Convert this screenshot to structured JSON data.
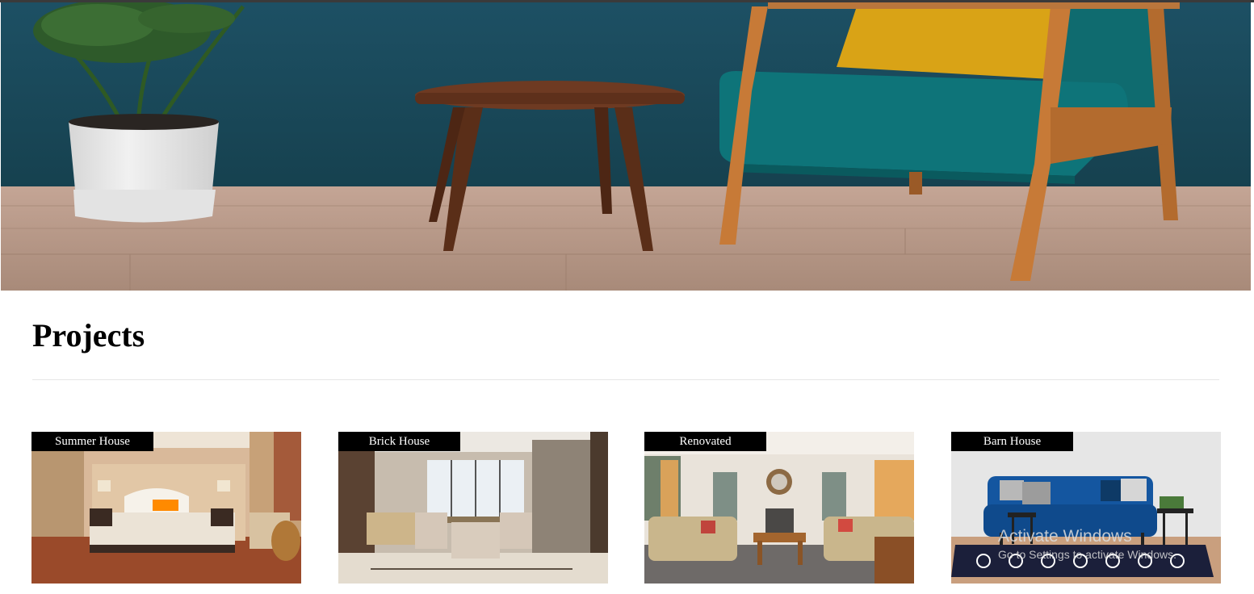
{
  "hero": {
    "image": "living-room-hero"
  },
  "projects": {
    "title": "Projects",
    "cards": [
      {
        "label": "Summer House",
        "image": "bedroom"
      },
      {
        "label": "Brick House",
        "image": "dining-room"
      },
      {
        "label": "Renovated",
        "image": "living-room"
      },
      {
        "label": "Barn House",
        "image": "blue-sofa-room"
      }
    ]
  },
  "watermark": {
    "title": "Activate Windows",
    "subtitle": "Go to Settings to activate Windows."
  },
  "colors": {
    "accent": "#000000",
    "wall": "#1f5468",
    "floor": "#b89a88"
  }
}
